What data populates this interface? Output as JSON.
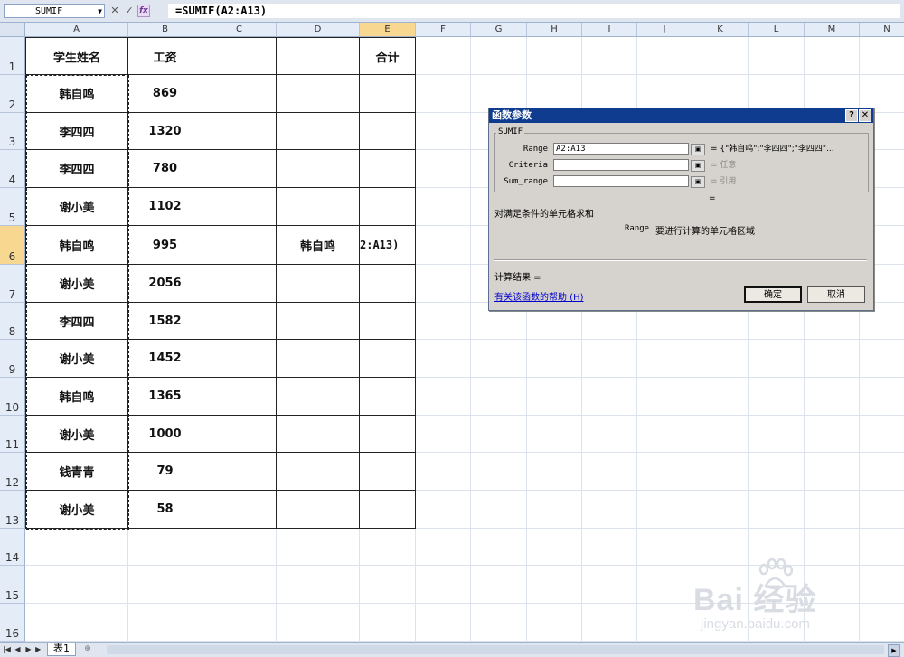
{
  "formula_bar": {
    "name_box": "SUMIF",
    "formula": "=SUMIF(A2:A13)"
  },
  "columns": [
    "A",
    "B",
    "C",
    "D",
    "E",
    "F",
    "G",
    "H",
    "I",
    "J",
    "K",
    "L",
    "M",
    "N"
  ],
  "rows": [
    "1",
    "2",
    "3",
    "4",
    "5",
    "6",
    "7",
    "8",
    "9",
    "10",
    "11",
    "12",
    "13",
    "14",
    "15",
    "16"
  ],
  "table": {
    "header": {
      "name": "学生姓名",
      "salary": "工资",
      "total": "合计"
    },
    "records": [
      {
        "name": "韩自鸣",
        "salary": "869"
      },
      {
        "name": "李四四",
        "salary": "1320"
      },
      {
        "name": "李四四",
        "salary": "780"
      },
      {
        "name": "谢小美",
        "salary": "1102"
      },
      {
        "name": "韩自鸣",
        "salary": "995"
      },
      {
        "name": "谢小美",
        "salary": "2056"
      },
      {
        "name": "李四四",
        "salary": "1582"
      },
      {
        "name": "谢小美",
        "salary": "1452"
      },
      {
        "name": "韩自鸣",
        "salary": "1365"
      },
      {
        "name": "谢小美",
        "salary": "1000"
      },
      {
        "name": "钱青青",
        "salary": "79"
      },
      {
        "name": "谢小美",
        "salary": "58"
      }
    ],
    "d6": "韩自鸣",
    "e6_edit": "2:A13)"
  },
  "dialog": {
    "title": "函数参数",
    "function_name": "SUMIF",
    "args": [
      {
        "label": "Range",
        "value": "A2:A13",
        "result": "= {\"韩自鸣\";\"李四四\";\"李四四\"..."
      },
      {
        "label": "Criteria",
        "value": "",
        "result": "= 任意"
      },
      {
        "label": "Sum_range",
        "value": "",
        "result": "= 引用"
      }
    ],
    "eq_line": "=",
    "description": "对满足条件的单元格求和",
    "arg_help_label": "Range",
    "arg_help_text": "要进行计算的单元格区域",
    "result_label": "计算结果 =",
    "help_link": "有关该函数的帮助 (H)",
    "ok": "确定",
    "cancel": "取消"
  },
  "sheet_tabs": [
    "表1"
  ],
  "watermark": {
    "brand": "Bai 经验",
    "url": "jingyan.baidu.com"
  }
}
